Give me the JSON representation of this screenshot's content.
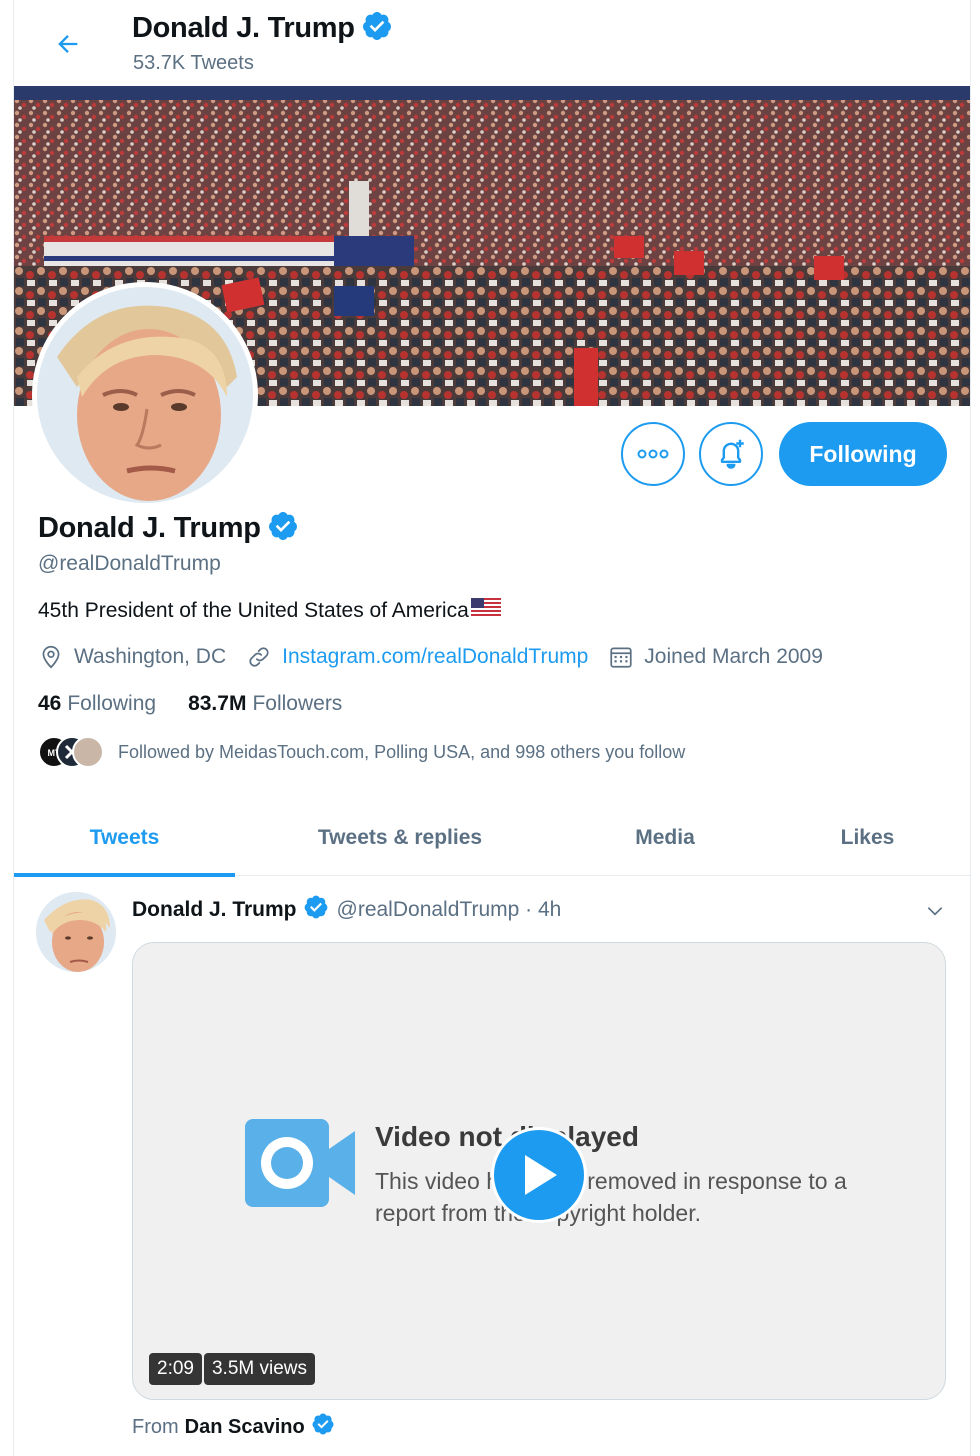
{
  "header": {
    "name": "Donald J. Trump",
    "tweet_count": "53.7K Tweets"
  },
  "profile": {
    "name": "Donald J. Trump",
    "handle": "@realDonaldTrump",
    "bio": "45th President of the United States of America",
    "location": "Washington, DC",
    "website": "Instagram.com/realDonaldTrump",
    "joined": "Joined March 2009",
    "following_count": "46",
    "following_label": "Following",
    "followers_count": "83.7M",
    "followers_label": "Followers",
    "followed_by": "Followed by MeidasTouch.com, Polling USA, and 998 others you follow",
    "follow_button": "Following"
  },
  "tabs": [
    "Tweets",
    "Tweets & replies",
    "Media",
    "Likes"
  ],
  "active_tab": "Tweets",
  "tweet": {
    "author_name": "Donald J. Trump",
    "author_handle_time": "@realDonaldTrump · 4h",
    "media": {
      "title": "Video not displayed",
      "text": "This video has been removed in response to a report from the copyright holder.",
      "duration": "2:09",
      "views": "3.5M views"
    },
    "from_label": "From",
    "from_name": "Dan Scavino"
  },
  "colors": {
    "accent": "#1d9bf0",
    "secondary_text": "#5b7083"
  },
  "icons": [
    "back-arrow-icon",
    "verified-badge-icon",
    "more-icon",
    "notification-bell-icon",
    "location-icon",
    "link-icon",
    "calendar-icon",
    "chevron-down-icon",
    "video-camera-icon",
    "play-icon"
  ]
}
